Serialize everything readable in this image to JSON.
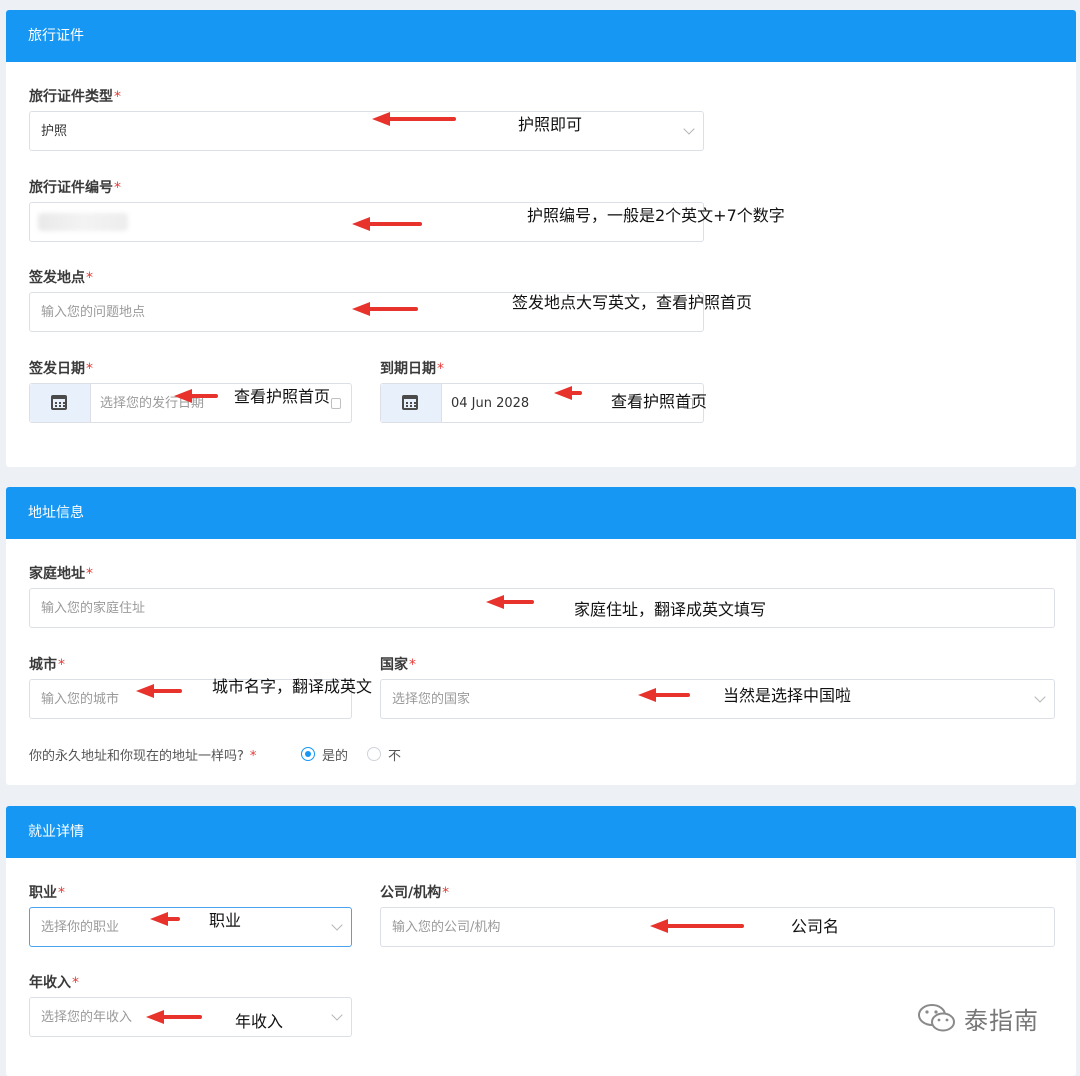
{
  "travel": {
    "header": "旅行证件",
    "doc_type_label": "旅行证件类型",
    "doc_type_value": "护照",
    "doc_type_note": "护照即可",
    "doc_number_label": "旅行证件编号",
    "doc_number_note": "护照编号，一般是2个英文+7个数字",
    "issue_place_label": "签发地点",
    "issue_place_placeholder": "输入您的问题地点",
    "issue_place_note": "签发地点大写英文，查看护照首页",
    "issue_date_label": "签发日期",
    "issue_date_placeholder": "选择您的发行日期",
    "issue_date_note": "查看护照首页",
    "expiry_date_label": "到期日期",
    "expiry_date_value": "04 Jun 2028",
    "expiry_date_note": "查看护照首页",
    "required_mark": "*"
  },
  "address": {
    "header": "地址信息",
    "home_label": "家庭地址",
    "home_placeholder": "输入您的家庭住址",
    "home_note": "家庭住址，翻译成英文填写",
    "city_label": "城市",
    "city_placeholder": "输入您的城市",
    "city_note": "城市名字，翻译成英文",
    "country_label": "国家",
    "country_placeholder": "选择您的国家",
    "country_note": "当然是选择中国啦",
    "permanent_question": "你的永久地址和你现在的地址一样吗?",
    "option_yes": "是的",
    "option_no": "不",
    "selected": "是的"
  },
  "employment": {
    "header": "就业详情",
    "occupation_label": "职业",
    "occupation_placeholder": "选择你的职业",
    "occupation_note": "职业",
    "company_label": "公司/机构",
    "company_placeholder": "输入您的公司/机构",
    "company_note": "公司名",
    "income_label": "年收入",
    "income_placeholder": "选择您的年收入",
    "income_note": "年收入"
  },
  "watermark": {
    "text": "泰指南",
    "icon": "wechat-icon"
  },
  "colors": {
    "header_blue": "#1597f3",
    "required_red": "#e53935",
    "arrow_red": "#e8322c"
  }
}
